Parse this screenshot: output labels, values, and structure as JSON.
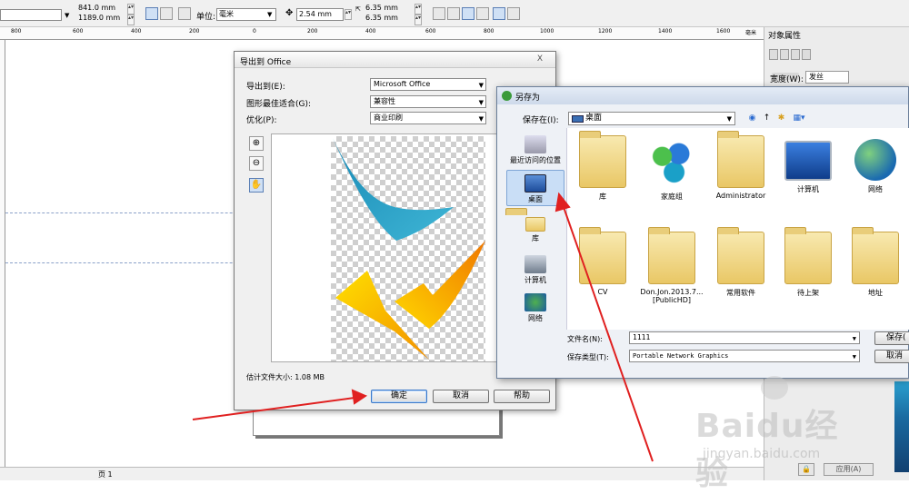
{
  "toolbar": {
    "width_value": "841.0 mm",
    "height_value": "1189.0 mm",
    "unit_label": "单位:",
    "unit_value": "毫米",
    "nudge_value": "2.54 mm",
    "dup_x": "6.35 mm",
    "dup_y": "6.35 mm"
  },
  "ruler": {
    "ticks": [
      "800",
      "600",
      "400",
      "200",
      "0",
      "200",
      "400",
      "600",
      "800",
      "1000",
      "1200",
      "1400",
      "1600"
    ],
    "unit": "毫米"
  },
  "right_panel": {
    "title": "对象属性",
    "width_label": "宽度(W):",
    "width_value": "发丝",
    "apply_label": "应用(A)"
  },
  "status": {
    "page_label": "页 1"
  },
  "export_dialog": {
    "title": "导出到 Office",
    "close": "X",
    "export_to_label": "导出到(E):",
    "export_to_value": "Microsoft Office",
    "graphic_fit_label": "图形最佳适合(G):",
    "graphic_fit_value": "兼容性",
    "optimize_label": "优化(P):",
    "optimize_value": "商业印刷",
    "estimate_label": "估计文件大小: 1.08 MB",
    "ok": "确定",
    "cancel": "取消",
    "help": "帮助"
  },
  "save_dialog": {
    "title": "另存为",
    "save_in_label": "保存在(I):",
    "save_in_value": "桌面",
    "places": [
      {
        "label": "最近访问的位置"
      },
      {
        "label": "桌面"
      },
      {
        "label": "库"
      },
      {
        "label": "计算机"
      },
      {
        "label": "网络"
      }
    ],
    "files": [
      {
        "label": "库"
      },
      {
        "label": "家庭组"
      },
      {
        "label": "Administrator"
      },
      {
        "label": "计算机"
      },
      {
        "label": "网络"
      },
      {
        "label": "CV"
      },
      {
        "label": "Don.Jon.2013.7... [PublicHD]"
      },
      {
        "label": "常用软件"
      },
      {
        "label": "待上架"
      },
      {
        "label": "地址"
      }
    ],
    "filename_label": "文件名(N):",
    "filename_value": "1111",
    "filetype_label": "保存类型(T):",
    "filetype_value": "Portable Network Graphics",
    "save_button": "保存(",
    "cancel_button": "取消"
  },
  "watermark": {
    "text": "Baidu经验",
    "sub": "jingyan.baidu.com"
  },
  "colors": {
    "accent_blue": "#2aa6c9",
    "accent_yellow": "#f5c400",
    "arrow_red": "#e02020"
  }
}
